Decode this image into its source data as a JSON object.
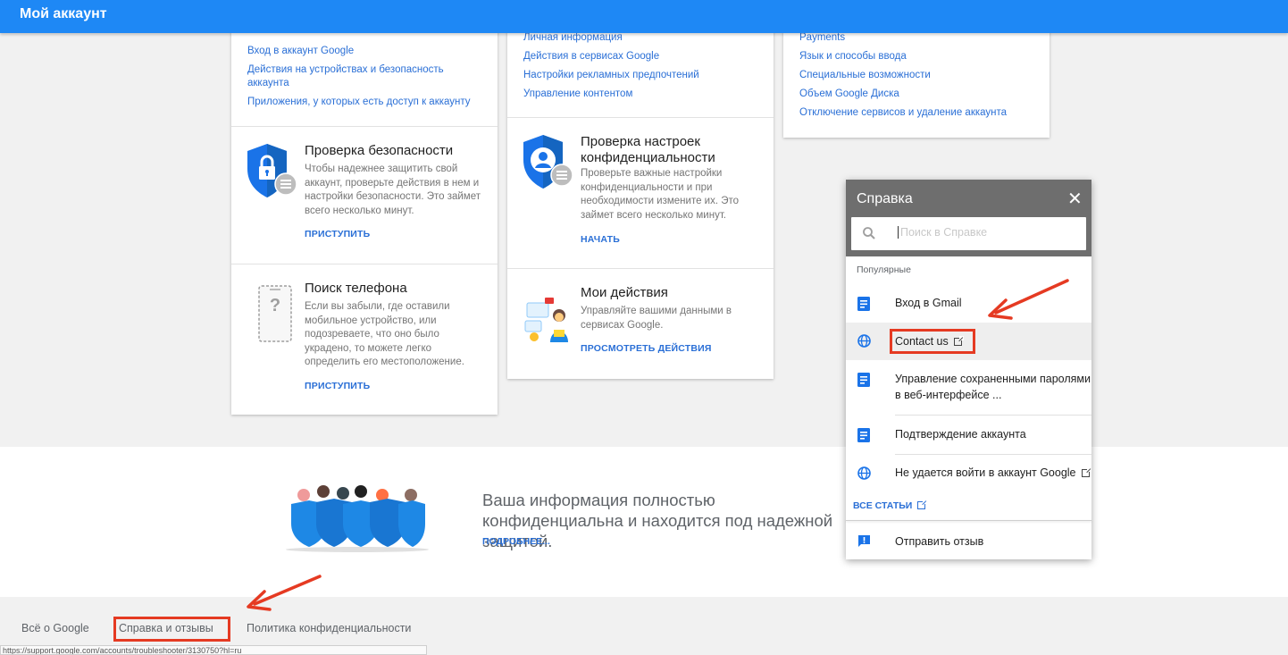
{
  "topbar": {
    "title": "Мой аккаунт"
  },
  "card_security_links": [
    "Вход в аккаунт Google",
    "Действия на устройствах и безопасность аккаунта",
    "Приложения, у которых есть доступ к аккаунту"
  ],
  "card_privacy_links": [
    "Личная информация",
    "Действия в сервисах Google",
    "Настройки рекламных предпочтений",
    "Управление контентом"
  ],
  "card_prefs_links": [
    "Payments",
    "Язык и способы ввода",
    "Специальные возможности",
    "Объем Google Диска",
    "Отключение сервисов и удаление аккаунта"
  ],
  "security_checkup": {
    "title": "Проверка безопасности",
    "desc": "Чтобы надежнее защитить свой аккаунт, проверьте действия в нем и настройки безопасности. Это займет всего несколько минут.",
    "action": "ПРИСТУПИТЬ",
    "icon": "security-shield-lock-icon"
  },
  "find_phone": {
    "title": "Поиск телефона",
    "desc": "Если вы забыли, где оставили мобильное устройство, или подозреваете, что оно было украдено, то можете легко определить его местоположение.",
    "action": "ПРИСТУПИТЬ",
    "icon": "phone-question-icon"
  },
  "privacy_checkup": {
    "title": "Проверка настроек конфиденциальности",
    "desc": "Проверьте важные настройки конфиденциальности и при необходимости измените их. Это займет всего несколько минут.",
    "action": "НАЧАТЬ",
    "icon": "privacy-shield-user-icon"
  },
  "my_activity": {
    "title": "Мои действия",
    "desc": "Управляйте вашими данными в сервисах Google.",
    "action": "ПРОСМОТРЕТЬ ДЕЙСТВИЯ",
    "icon": "activity-illustration-icon"
  },
  "promo": {
    "text": "Ваша информация полностью конфиденциальна и находится под надежной защитой.",
    "more": "ПОДРОБНЕЕ..."
  },
  "footer": {
    "links": [
      "Всё о Google",
      "Справка и отзывы",
      "Политика конфиденциальности"
    ]
  },
  "status_url": "https://support.google.com/accounts/troubleshooter/3130750?hl=ru",
  "help": {
    "title": "Справка",
    "search_placeholder": "Поиск в Справке",
    "popular_label": "Популярные",
    "items": [
      {
        "label": "Вход в Gmail",
        "icon": "article-icon"
      },
      {
        "label": "Contact us",
        "icon": "globe-icon",
        "external": true
      },
      {
        "label": "Управление сохраненными паролями в веб-интерфейсе ...",
        "icon": "article-icon"
      },
      {
        "label": "Подтверждение аккаунта",
        "icon": "article-icon"
      },
      {
        "label": "Не удается войти в аккаунт Google",
        "icon": "globe-icon",
        "external": true
      }
    ],
    "all_articles": "ВСЕ СТАТЬИ",
    "feedback": "Отправить отзыв"
  },
  "colors": {
    "topbar": "#1e88f5",
    "link": "#2a6fd6",
    "help_header": "#6e6e6e",
    "highlight": "#e53a22"
  }
}
